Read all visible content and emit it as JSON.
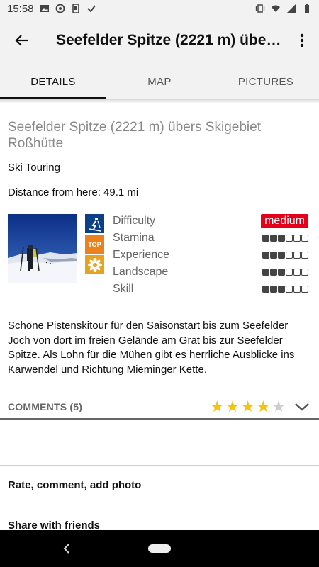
{
  "status_bar": {
    "time": "15:58"
  },
  "app_bar": {
    "title": "Seefelder Spitze (2221 m) übers Skigebiet Roßhütte"
  },
  "tabs": [
    {
      "label": "DETAILS",
      "active": true
    },
    {
      "label": "MAP",
      "active": false
    },
    {
      "label": "PICTURES",
      "active": false
    }
  ],
  "tour": {
    "title": "Seefelder Spitze (2221 m) übers Skigebiet Roßhütte",
    "type": "Ski Touring",
    "distance": "Distance from here: 49.1 mi",
    "category_icons": [
      "ski-touring-icon",
      "top-icon",
      "edelweiss-icon"
    ],
    "top_label": "TOP"
  },
  "ratings": {
    "difficulty_label": "Difficulty",
    "difficulty_value": "medium",
    "difficulty_color": "#e4001b",
    "stamina_label": "Stamina",
    "stamina_level": 3,
    "experience_label": "Experience",
    "experience_level": 3,
    "landscape_label": "Landscape",
    "landscape_level": 3,
    "skill_label": "Skill",
    "skill_level": 3,
    "max_level": 6
  },
  "description": "Schöne Pistenskitour für den Saisonstart bis zum Seefelder Joch von dort im freien Gelände am Grat bis zur Seefelder Spitze. Als Lohn für die Mühen gibt es herrliche Ausblicke ins Karwendel und Richtung Mieminger Kette.",
  "comments": {
    "label": "COMMENTS (5)",
    "rating": 4,
    "max_rating": 5,
    "star_color": "#f6c20a",
    "star_empty_color": "#cccccc"
  },
  "actions": {
    "rate_label": "Rate, comment, add photo",
    "share_label": "Share with friends"
  }
}
